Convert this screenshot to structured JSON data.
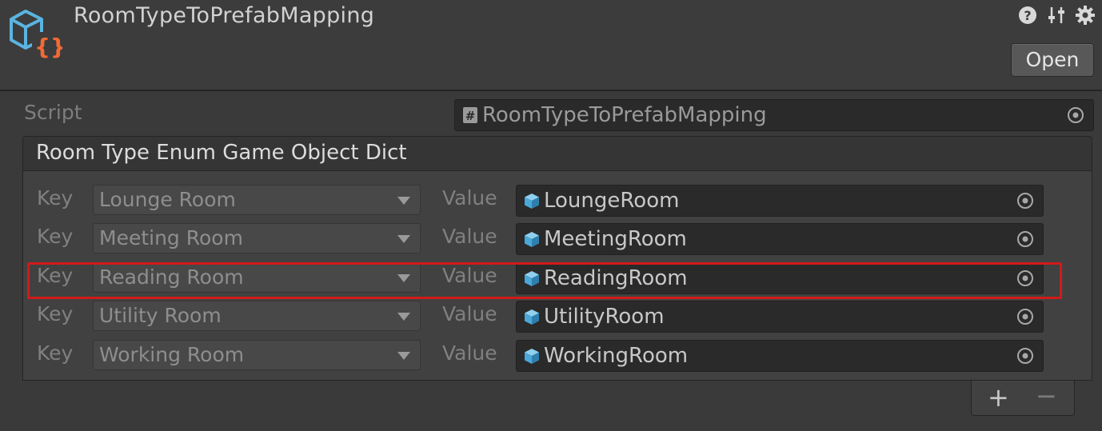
{
  "header": {
    "title": "RoomTypeToPrefabMapping",
    "icons": [
      "help-icon",
      "preset-icon",
      "settings-icon"
    ],
    "open_label": "Open"
  },
  "script": {
    "label": "Script",
    "value": "RoomTypeToPrefabMapping",
    "icon": "script-icon"
  },
  "dict": {
    "label": "Room Type Enum Game Object Dict",
    "key_label": "Key",
    "value_label": "Value",
    "entries": [
      {
        "key": "Lounge Room",
        "value": "LoungeRoom"
      },
      {
        "key": "Meeting Room",
        "value": "MeetingRoom"
      },
      {
        "key": "Reading Room",
        "value": "ReadingRoom"
      },
      {
        "key": "Utility Room",
        "value": "UtilityRoom"
      },
      {
        "key": "Working Room",
        "value": "WorkingRoom"
      }
    ],
    "add_label": "+",
    "remove_label": "−"
  },
  "colors": {
    "background": "#3a3a3a",
    "field": "#2a2a2a",
    "highlight": "#d11a1a",
    "prefab_icon": "#4aa8d8"
  }
}
